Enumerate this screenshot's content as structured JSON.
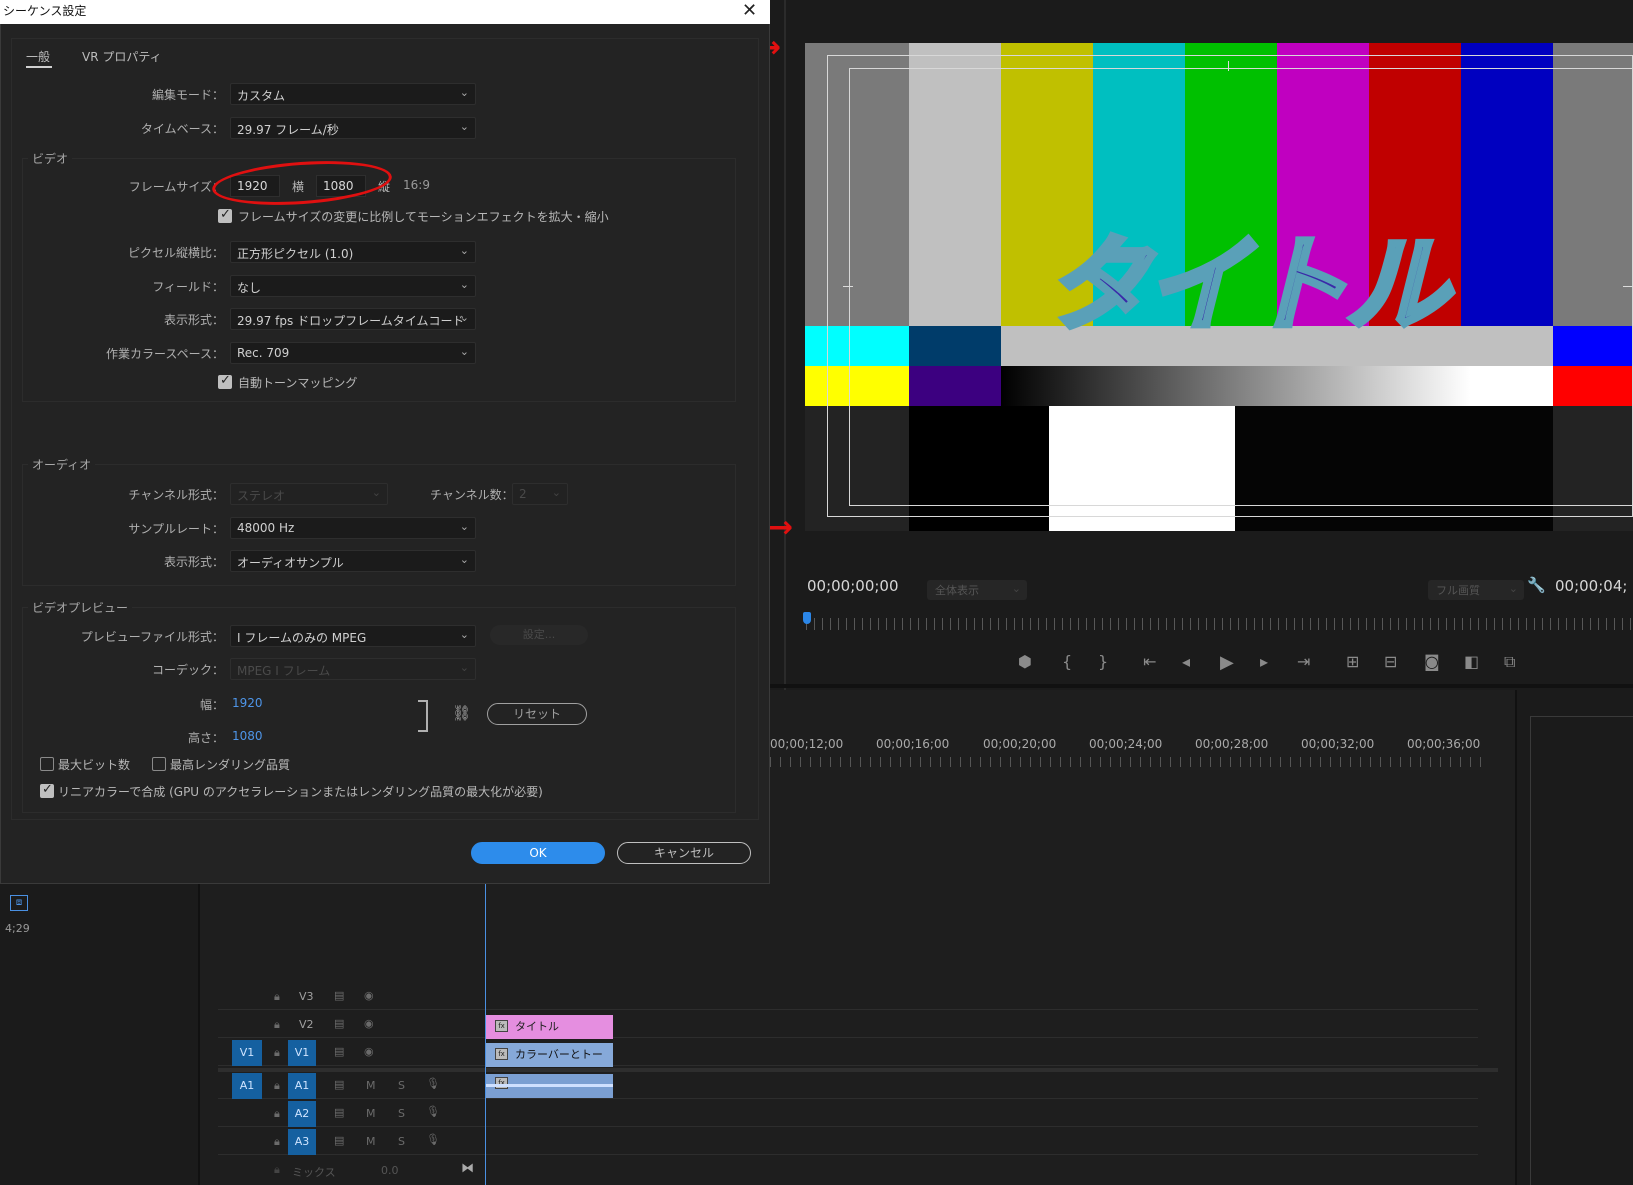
{
  "dialog": {
    "title": "シーケンス設定",
    "tabs": [
      "一般",
      "VR プロパティ"
    ],
    "edit_mode": {
      "label": "編集モード：",
      "value": "カスタム"
    },
    "timebase": {
      "label": "タイムベース：",
      "value": "29.97  フレーム/秒"
    },
    "video": {
      "section": "ビデオ",
      "frame_size_label": "フレームサイズ：",
      "width": "1920",
      "h_label": "横",
      "height": "1080",
      "v_label": "縦",
      "aspect": "16:9",
      "scale_motion": "フレームサイズの変更に比例してモーションエフェクトを拡大・縮小",
      "pixel_aspect": {
        "label": "ピクセル縦横比：",
        "value": "正方形ピクセル (1.0)"
      },
      "fields": {
        "label": "フィールド：",
        "value": "なし"
      },
      "display_format": {
        "label": "表示形式：",
        "value": "29.97  fps  ドロップフレームタイムコード"
      },
      "color_space": {
        "label": "作業カラースペース：",
        "value": "Rec. 709"
      },
      "tone_mapping": "自動トーンマッピング"
    },
    "audio": {
      "section": "オーディオ",
      "channel_format": {
        "label": "チャンネル形式：",
        "value": "ステレオ"
      },
      "channel_count": {
        "label": "チャンネル数：",
        "value": "2"
      },
      "sample_rate": {
        "label": "サンプルレート：",
        "value": "48000 Hz"
      },
      "display_format": {
        "label": "表示形式：",
        "value": "オーディオサンプル"
      }
    },
    "preview": {
      "section": "ビデオプレビュー",
      "file_format": {
        "label": "プレビューファイル形式：",
        "value": "I フレームのみの  MPEG"
      },
      "settings_btn": "設定...",
      "codec": {
        "label": "コーデック：",
        "value": "MPEG  I  フレーム"
      },
      "width_label": "幅：",
      "width": "1920",
      "height_label": "高さ：",
      "height": "1080",
      "reset": "リセット",
      "max_bit_depth": "最大ビット数",
      "max_render_quality": "最高レンダリング品質",
      "linear_color": "リニアカラーで合成 (GPU のアクセラレーションまたはレンダリング品質の最大化が必要)"
    },
    "ok": "OK",
    "cancel": "キャンセル"
  },
  "program": {
    "title_overlay": "タイトル",
    "timecode": "00;00;00;00",
    "fit": "全体表示",
    "quality": "フル画質",
    "end_timecode": "00;00;04;"
  },
  "timeline": {
    "times": [
      "00;00;12;00",
      "00;00;16;00",
      "00;00;20;00",
      "00;00;24;00",
      "00;00;28;00",
      "00;00;32;00",
      "00;00;36;00"
    ],
    "tracks": {
      "v3": "V3",
      "v2": "V2",
      "v1": "V1",
      "a1": "A1",
      "a2": "A2",
      "a3": "A3"
    },
    "mix_label": "ミックス",
    "mix_value": "0.0",
    "clip_title": "タイトル",
    "clip_bars": "カラーバーとトー",
    "m": "M",
    "s": "S",
    "fx": "fx"
  },
  "left_panel": {
    "duration": "4;29"
  },
  "colors": {
    "accent": "#2d8ceb",
    "annotation": "#e01010"
  }
}
